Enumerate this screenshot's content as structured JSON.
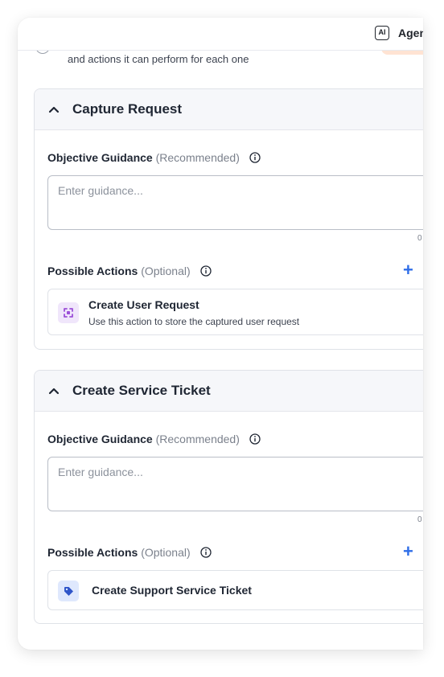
{
  "header": {
    "ai_badge": "AI",
    "agent_label": "Agen"
  },
  "intro": {
    "text": "and actions it can perform for each one"
  },
  "sections": [
    {
      "title": "Capture Request",
      "guidance_label": "Objective Guidance",
      "guidance_hint": "(Recommended)",
      "guidance_placeholder": "Enter guidance...",
      "counter": "0",
      "actions_label": "Possible Actions",
      "actions_hint": "(Optional)",
      "add_label": "+",
      "action": {
        "title": "Create User Request",
        "description": "Use this action to store the captured user request",
        "icon": "expand-icon"
      }
    },
    {
      "title": "Create Service Ticket",
      "guidance_label": "Objective Guidance",
      "guidance_hint": "(Recommended)",
      "guidance_placeholder": "Enter guidance...",
      "counter": "0",
      "actions_label": "Possible Actions",
      "actions_hint": "(Optional)",
      "add_label": "+",
      "action": {
        "title": "Create Support Service Ticket",
        "icon": "tag-icon"
      }
    }
  ],
  "colors": {
    "accent": "#2f6ee8",
    "purple_icon_bg": "#f0e6fb",
    "purple_icon": "#9b4fd8",
    "blue_icon_bg": "#dfe8fd",
    "blue_icon": "#2f55c9"
  }
}
